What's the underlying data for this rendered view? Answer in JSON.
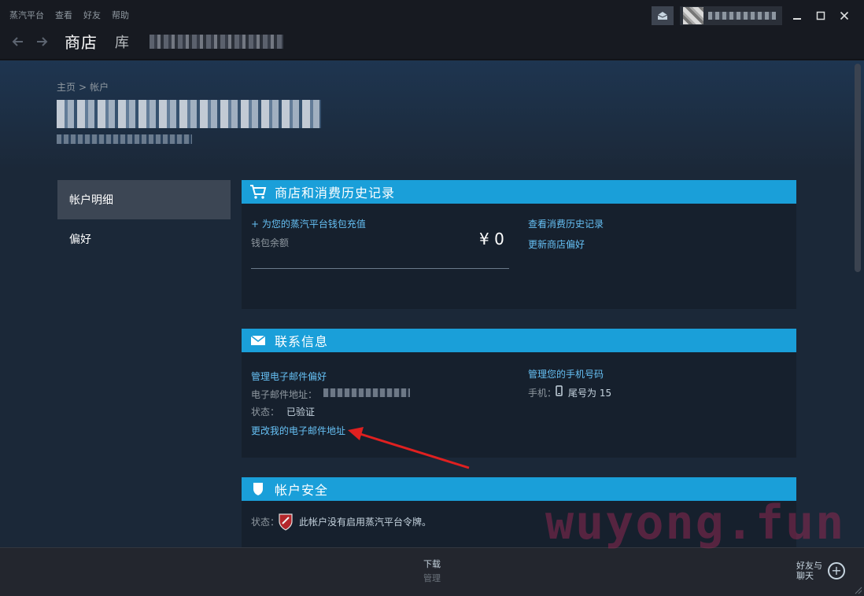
{
  "menu": {
    "items": [
      "蒸汽平台",
      "查看",
      "好友",
      "帮助"
    ]
  },
  "nav": {
    "store": "商店",
    "library": "库"
  },
  "breadcrumb": {
    "home": "主页",
    "separator": ">",
    "current": "帐户"
  },
  "sidebar": {
    "items": [
      {
        "label": "帐户明细"
      },
      {
        "label": "偏好"
      }
    ]
  },
  "store_history": {
    "title": "商店和消费历史记录",
    "add_funds": "+ 为您的蒸汽平台钱包充值",
    "wallet_label": "钱包余额",
    "wallet_value": "¥ 0",
    "view_history": "查看消费历史记录",
    "update_prefs": "更新商店偏好"
  },
  "contact": {
    "title": "联系信息",
    "manage_email": "管理电子邮件偏好",
    "email_label": "电子邮件地址：",
    "status_label": "状态：",
    "status_value": "已验证",
    "change_email": "更改我的电子邮件地址",
    "manage_phone": "管理您的手机号码",
    "phone_label": "手机：",
    "phone_value": "尾号为 15"
  },
  "security": {
    "title": "帐户安全",
    "status_label": "状态：",
    "status_value": "此帐户没有启用蒸汽平台令牌。"
  },
  "bottom": {
    "downloads": "下载",
    "manage": "管理",
    "friends": "好友与聊天"
  },
  "watermark": "wuyong.fun",
  "colors": {
    "accent": "#1a9fd9",
    "link": "#66c0f4",
    "arrow": "#e02020"
  }
}
